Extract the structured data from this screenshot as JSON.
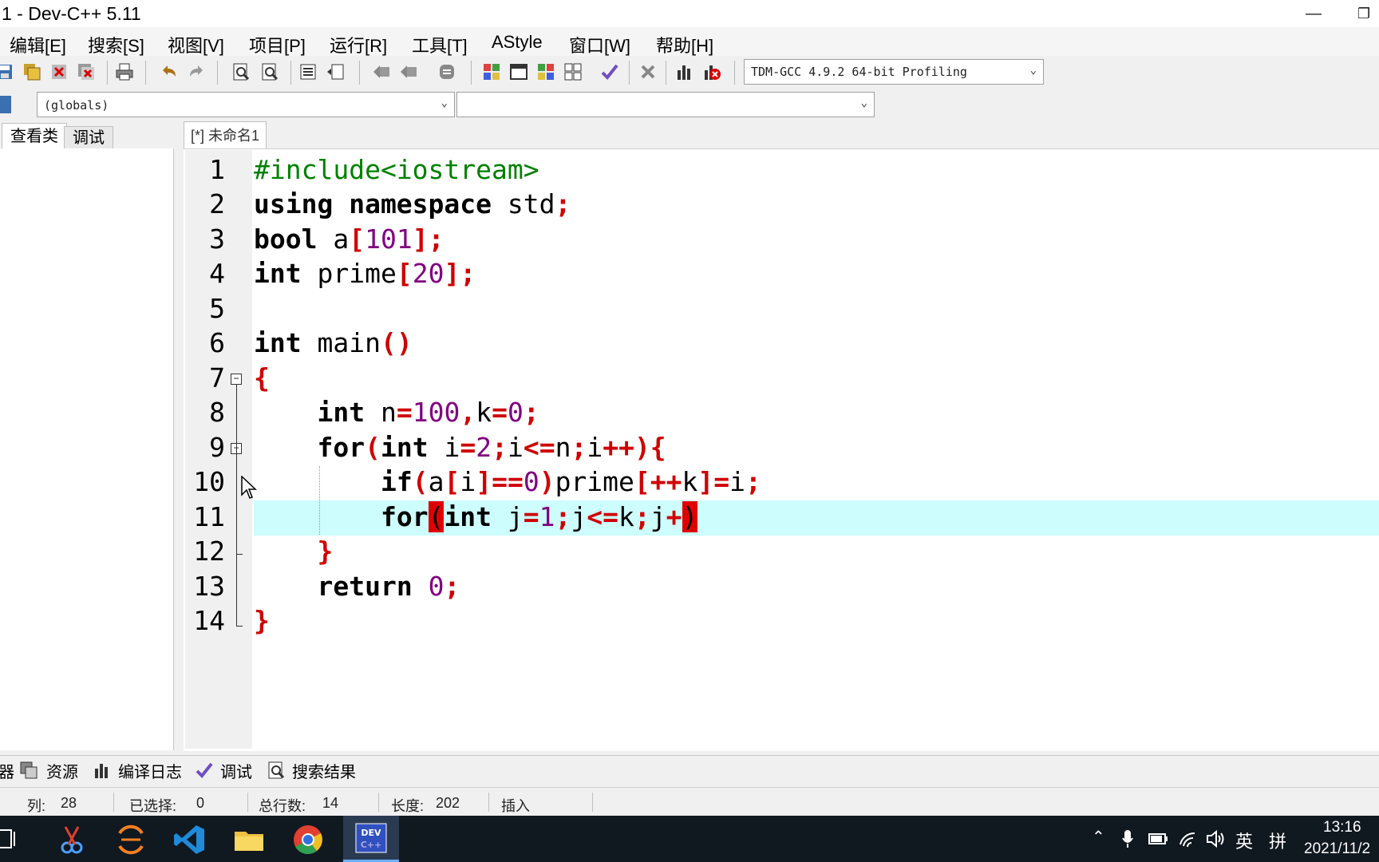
{
  "window": {
    "title": "1 - Dev-C++ 5.11",
    "minimize_glyph": "—",
    "restore_glyph": "❐"
  },
  "menu": [
    "编辑[E]",
    "搜索[S]",
    "视图[V]",
    "项目[P]",
    "运行[R]",
    "工具[T]",
    "AStyle",
    "窗口[W]",
    "帮助[H]"
  ],
  "toolbar": {
    "compiler": "TDM-GCC 4.9.2 64-bit Profiling"
  },
  "class_bar": {
    "scope": "(globals)",
    "member": ""
  },
  "left_panel": {
    "tabs": [
      "查看类",
      "调试"
    ]
  },
  "editor": {
    "tab_label": "[*] 未命名1",
    "line_numbers": [
      "1",
      "2",
      "3",
      "4",
      "5",
      "6",
      "7",
      "8",
      "9",
      "10",
      "11",
      "12",
      "13",
      "14"
    ],
    "current_line": 11
  },
  "bottom_tabs": [
    "器",
    "资源",
    "编译日志",
    "调试",
    "搜索结果"
  ],
  "status": {
    "col_label": "列:",
    "col_value": "28",
    "selected_label": "已选择:",
    "selected_value": "0",
    "lines_label": "总行数:",
    "lines_value": "14",
    "length_label": "长度:",
    "length_value": "202",
    "mode": "插入"
  },
  "taskbar": {
    "time": "13:16",
    "date": "2021/11/2",
    "ime": "英",
    "ime2": "拼"
  },
  "colors": {
    "current_line_bg": "#cdfdfd",
    "bracket_match": "#e00000",
    "keyword": "#000000",
    "preprocessor": "#008000",
    "number": "#800080",
    "symbol": "#d00000"
  }
}
